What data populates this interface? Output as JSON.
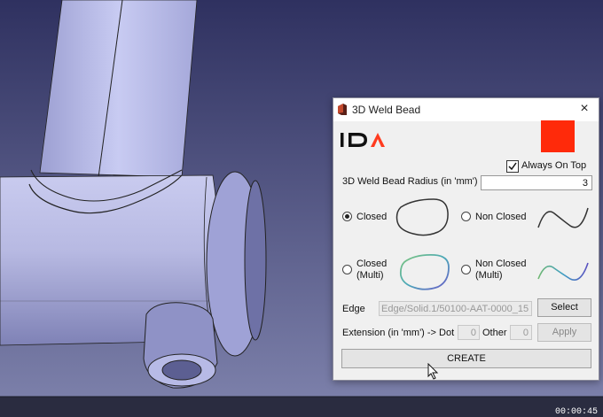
{
  "dialog": {
    "title": "3D Weld Bead",
    "close_glyph": "×",
    "logo_name": "IDA",
    "color_swatch": "#ff2a0a",
    "always_on_top": {
      "label": "Always On Top",
      "checked": true
    },
    "radius": {
      "label": "3D Weld Bead Radius (in 'mm')",
      "value": "3"
    },
    "options": {
      "closed": {
        "label": "Closed",
        "selected": true
      },
      "non_closed": {
        "label": "Non Closed",
        "selected": false
      },
      "closed_multi": {
        "label": "Closed\n(Multi)",
        "line1": "Closed",
        "line2": "(Multi)",
        "selected": false
      },
      "non_closed_multi": {
        "label": "Non Closed\n(Multi)",
        "line1": "Non Closed",
        "line2": "(Multi)",
        "selected": false
      }
    },
    "edge": {
      "label": "Edge",
      "value": "Edge/Solid.1/50100-AAT-0000_15",
      "button": "Select"
    },
    "extension": {
      "label": "Extension (in 'mm') -> Dot",
      "dot_value": "0",
      "other_label": "Other",
      "other_value": "0",
      "button": "Apply"
    },
    "create_button": "CREATE"
  },
  "video_timestamp": "00:00:45",
  "icons": [
    "app-icon",
    "close-icon",
    "ida-logo",
    "checkmark-icon",
    "closed-shape-icon",
    "open-curve-icon",
    "closed-multi-shape-icon",
    "open-multi-curve-icon",
    "mouse-cursor-icon"
  ],
  "colors": {
    "viewport_bg": "#3d3f6e",
    "dialog_bg": "#f0f0f0",
    "accent": "#ff2a0a"
  }
}
